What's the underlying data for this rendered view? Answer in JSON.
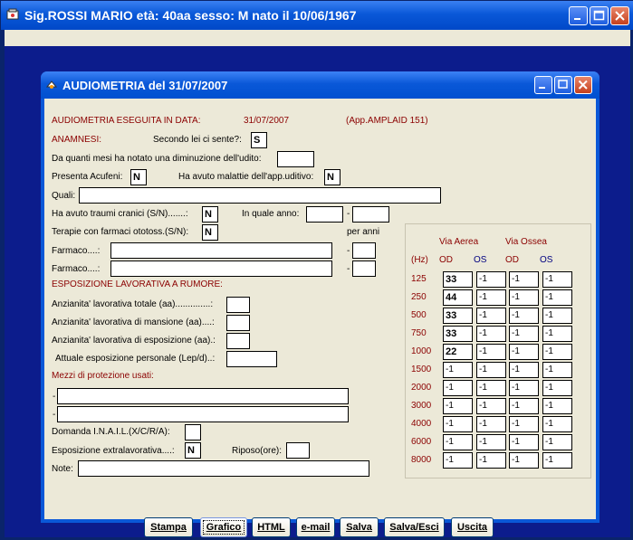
{
  "main_window": {
    "title": "Sig.ROSSI MARIO età: 40aa sesso: M nato il 10/06/1967"
  },
  "child_window": {
    "title": "AUDIOMETRIA  del 31/07/2007"
  },
  "header": {
    "exam_label": "AUDIOMETRIA ESEGUITA IN DATA:",
    "exam_date": "31/07/2007",
    "device": "(App.AMPLAID 151)"
  },
  "anamnesis": {
    "section_label": "ANAMNESI:",
    "hearing_question": "Secondo lei ci sente?:",
    "hearing_value": "S",
    "months_question": "Da quanti mesi ha notato una diminuzione dell'udito:",
    "months_value": "",
    "tinnitus_label": "Presenta Acufeni:",
    "tinnitus_value": "N",
    "disease_label": "Ha avuto malattie dell'app.uditivo:",
    "disease_value": "N",
    "which_label": "Quali:",
    "which_value": "",
    "trauma_label": "Ha avuto traumi cranici (S/N).......:",
    "trauma_value": "N",
    "year_label": "In quale anno:",
    "year_value": "",
    "year_dash": "-",
    "year_value2": "",
    "drug_therapy_label": "Terapie con farmaci ototoss.(S/N):",
    "drug_therapy_value": "N",
    "years_for_label": "per anni",
    "drug1_label": "Farmaco....:",
    "drug1_value": "",
    "drug1_dash": "-",
    "drug1_years": "",
    "drug2_label": "Farmaco....:",
    "drug2_value": "",
    "drug2_dash": "-",
    "drug2_years": ""
  },
  "exposure": {
    "section_label": "ESPOSIZIONE LAVORATIVA A RUMORE:",
    "total_label": "Anzianita' lavorativa totale (aa)..............:",
    "total_value": "",
    "task_label": "Anzianita' lavorativa di mansione (aa)....:",
    "task_value": "",
    "exposure_label": "Anzianita' lavorativa di esposizione (aa).:",
    "exposure_value": "",
    "personal_label": "Attuale esposizione personale (Lep/d)..:",
    "personal_value": "",
    "protection_label": "Mezzi di protezione usati:",
    "protection_dash1": "-",
    "protection1": "",
    "protection_dash2": "-",
    "protection2": "",
    "inail_label": "Domanda I.N.A.I.L.(X/C/R/A):",
    "inail_value": "",
    "extra_label": "Esposizione extralavorativa....:",
    "extra_value": "N",
    "rest_label": "Riposo(ore):",
    "rest_value": "",
    "notes_label": "Note:",
    "notes_value": ""
  },
  "audiogram": {
    "air_label": "Via Aerea",
    "bone_label": "Via Ossea",
    "hz_label": "(Hz)",
    "od_label": "OD",
    "os_label": "OS",
    "od2_label": "OD",
    "os2_label": "OS",
    "rows": [
      {
        "freq": "125",
        "air_od": "33",
        "air_os": "-1",
        "bone_od": "-1",
        "bone_os": "-1"
      },
      {
        "freq": "250",
        "air_od": "44",
        "air_os": "-1",
        "bone_od": "-1",
        "bone_os": "-1"
      },
      {
        "freq": "500",
        "air_od": "33",
        "air_os": "-1",
        "bone_od": "-1",
        "bone_os": "-1"
      },
      {
        "freq": "750",
        "air_od": "33",
        "air_os": "-1",
        "bone_od": "-1",
        "bone_os": "-1"
      },
      {
        "freq": "1000",
        "air_od": "22",
        "air_os": "-1",
        "bone_od": "-1",
        "bone_os": "-1"
      },
      {
        "freq": "1500",
        "air_od": "-1",
        "air_os": "-1",
        "bone_od": "-1",
        "bone_os": "-1"
      },
      {
        "freq": "2000",
        "air_od": "-1",
        "air_os": "-1",
        "bone_od": "-1",
        "bone_os": "-1"
      },
      {
        "freq": "3000",
        "air_od": "-1",
        "air_os": "-1",
        "bone_od": "-1",
        "bone_os": "-1"
      },
      {
        "freq": "4000",
        "air_od": "-1",
        "air_os": "-1",
        "bone_od": "-1",
        "bone_os": "-1"
      },
      {
        "freq": "6000",
        "air_od": "-1",
        "air_os": "-1",
        "bone_od": "-1",
        "bone_os": "-1"
      },
      {
        "freq": "8000",
        "air_od": "-1",
        "air_os": "-1",
        "bone_od": "-1",
        "bone_os": "-1"
      }
    ]
  },
  "buttons": {
    "print": "Stampa",
    "chart": "Grafico",
    "html": "HTML",
    "email": "e-mail",
    "save": "Salva",
    "save_exit": "Salva/Esci",
    "exit": "Uscita"
  }
}
